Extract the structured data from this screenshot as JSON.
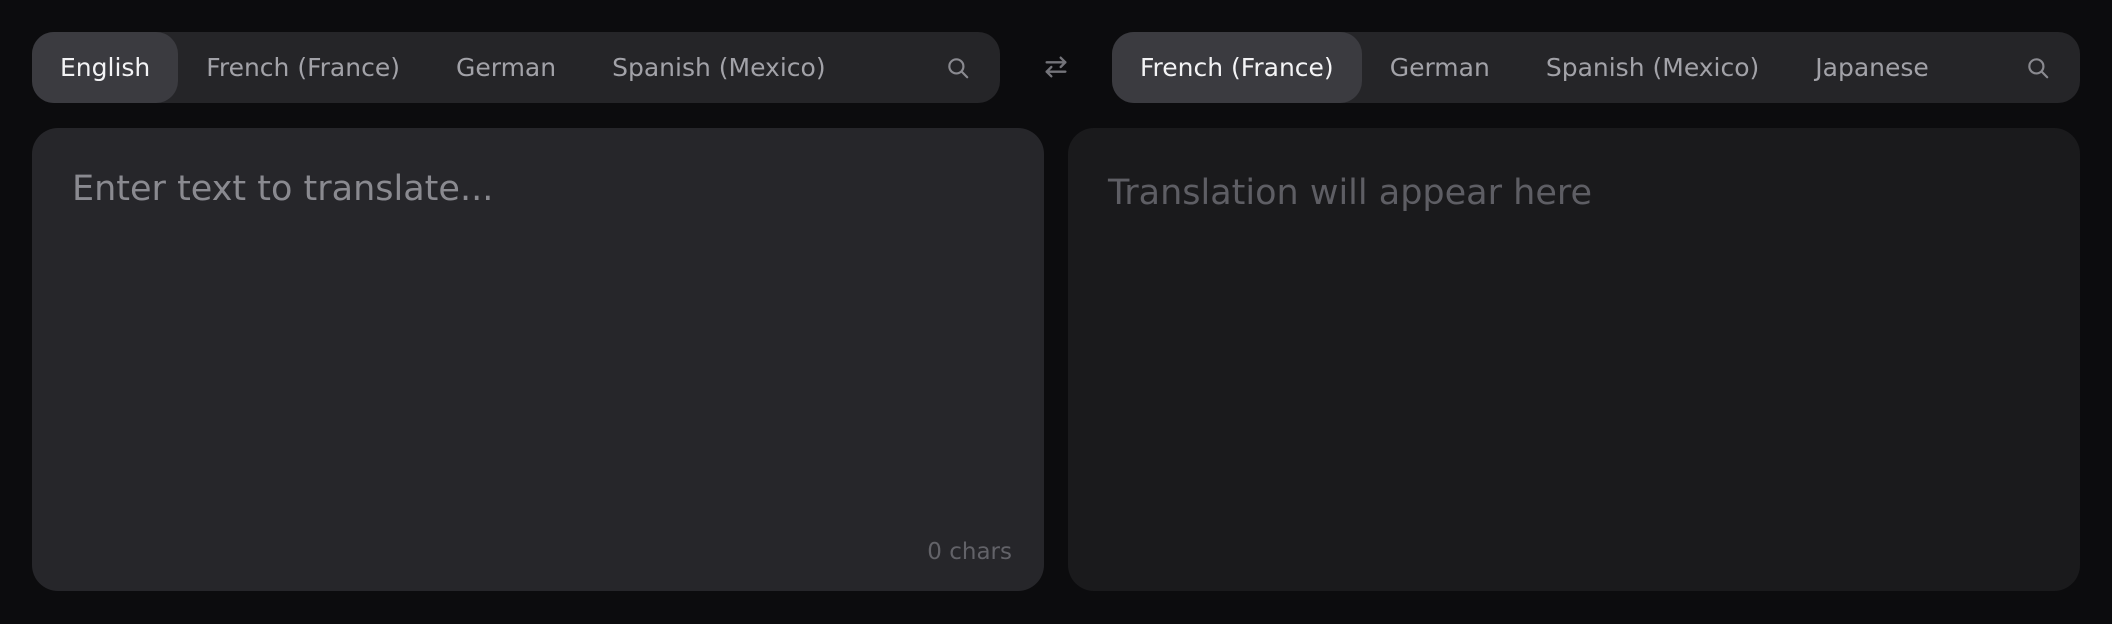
{
  "source": {
    "languages": [
      "English",
      "French (France)",
      "German",
      "Spanish (Mexico)"
    ],
    "active_index": 0,
    "search_icon": "search-icon"
  },
  "target": {
    "languages": [
      "French (France)",
      "German",
      "Spanish (Mexico)",
      "Japanese"
    ],
    "active_index": 0,
    "search_icon": "search-icon"
  },
  "swap_icon": "swap-arrows-icon",
  "input": {
    "placeholder": "Enter text to translate...",
    "value": "",
    "char_count": "0 chars"
  },
  "output": {
    "placeholder": "Translation will appear here"
  },
  "colors": {
    "background": "#0c0c0e",
    "bar": "#252528",
    "active_tab": "#3b3b40",
    "source_panel": "#26262a",
    "target_panel": "#1a1a1c"
  }
}
